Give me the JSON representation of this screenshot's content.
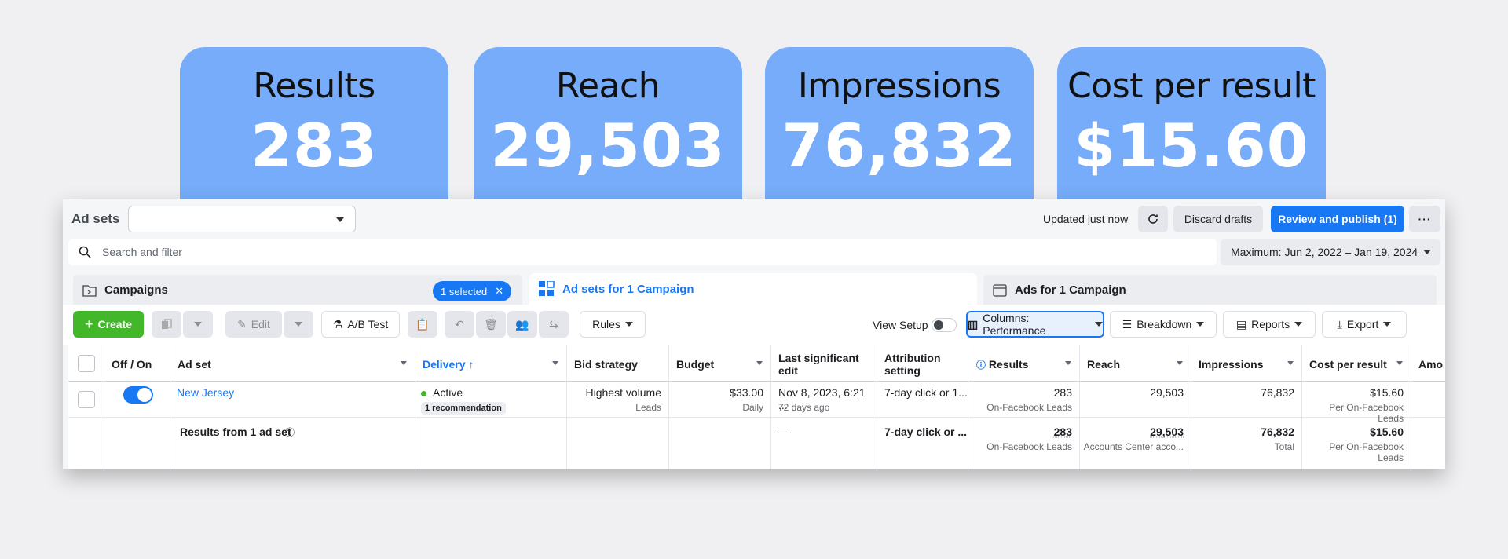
{
  "kpis": [
    {
      "label": "Results",
      "value": "283"
    },
    {
      "label": "Reach",
      "value": "29,503"
    },
    {
      "label": "Impressions",
      "value": "76,832"
    },
    {
      "label": "Cost per result",
      "value": "$15.60"
    }
  ],
  "colors": {
    "kpi_bg": "#76acf9",
    "primary": "#1877f2",
    "create": "#42b72a",
    "active_dot": "#42b72a"
  },
  "header": {
    "title": "Ad sets",
    "updated": "Updated just now",
    "discard": "Discard drafts",
    "publish": "Review and publish (1)"
  },
  "search": {
    "placeholder": "Search and filter"
  },
  "date_range": "Maximum: Jun 2, 2022 – Jan 19, 2024",
  "tabs": {
    "campaigns": "Campaigns",
    "selected": "1 selected",
    "adsets": "Ad sets for 1 Campaign",
    "ads": "Ads for 1 Campaign"
  },
  "toolbar": {
    "create": "Create",
    "edit": "Edit",
    "ab_test": "A/B Test",
    "rules": "Rules",
    "view_setup": "View Setup",
    "columns": "Columns: Performance",
    "breakdown": "Breakdown",
    "reports": "Reports",
    "export": "Export"
  },
  "table": {
    "headers": {
      "off_on": "Off / On",
      "ad_set": "Ad set",
      "delivery": "Delivery ↑",
      "bid_strategy": "Bid strategy",
      "budget": "Budget",
      "last_edit_1": "Last significant",
      "last_edit_2": "edit",
      "attribution_1": "Attribution",
      "attribution_2": "setting",
      "results": "Results",
      "reach": "Reach",
      "impressions": "Impressions",
      "cost_per_result": "Cost per result",
      "amount": "Amo"
    },
    "row": {
      "name": "New Jersey",
      "delivery": "Active",
      "recommendation": "1 recommendation",
      "bid_strategy": "Highest volume",
      "bid_strategy_sub": "Leads",
      "budget": "$33.00",
      "budget_sub": "Daily",
      "last_edit": "Nov 8, 2023, 6:21 ...",
      "last_edit_sub": "72 days ago",
      "attribution": "7-day click or 1...",
      "results": "283",
      "results_sub": "On-Facebook Leads",
      "reach": "29,503",
      "impressions": "76,832",
      "cost": "$15.60",
      "cost_sub": "Per On-Facebook Leads"
    },
    "summary": {
      "label": "Results from 1 ad set",
      "last_edit": "—",
      "attribution": "7-day click or ...",
      "results": "283",
      "results_sub": "On-Facebook Leads",
      "reach": "29,503",
      "reach_sub": "Accounts Center acco...",
      "impressions": "76,832",
      "impressions_sub": "Total",
      "cost": "$15.60",
      "cost_sub": "Per On-Facebook Leads"
    }
  }
}
